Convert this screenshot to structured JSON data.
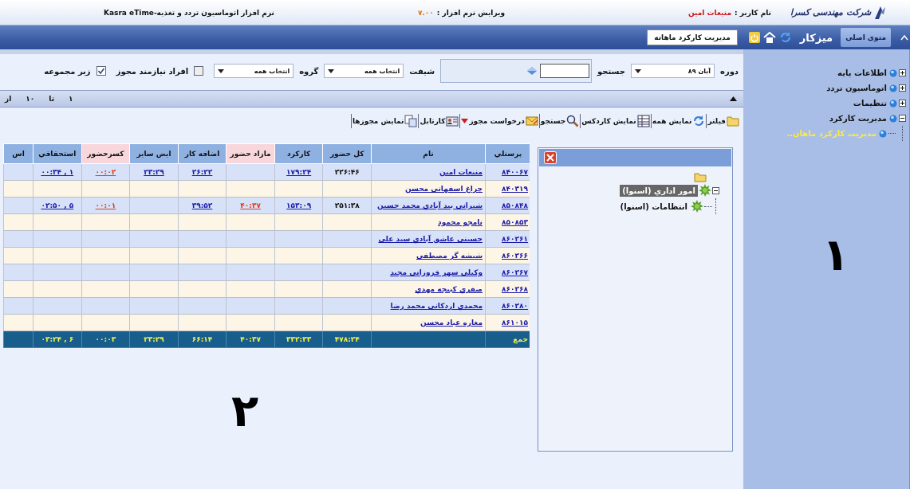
{
  "header": {
    "logo": "شرکت مهندسی کسرا",
    "user_label": "نام کاربر :",
    "user_name": "منيعات امين",
    "version_label": "ويرايش نرم افزار :",
    "version": "۷.۰۰",
    "product": "نرم افزار اتوماسيون تردد و تغذيه-Kasra eTime"
  },
  "nav": {
    "tabs": [
      {
        "label": "منوی اصلی",
        "selected": true
      },
      {
        "label": "ميزکار",
        "selected": false
      }
    ],
    "page_tab": "مديريت کارکرد ماهانه"
  },
  "filters": {
    "period_label": "دوره",
    "period": "آبان ۸۹",
    "search_label": "جستجو",
    "shift_label": "شيفت",
    "shift": "انتخاب همه",
    "group_label": "گروه",
    "group": "انتخاب همه",
    "checkboxes": [
      {
        "label": "افراد نيازمند مجوز",
        "checked": false
      },
      {
        "label": "زير مجموعه",
        "checked": true
      }
    ]
  },
  "pager": [
    "۱",
    "تا",
    "۱۰",
    "از"
  ],
  "toolbar": [
    {
      "label": "فيلتر",
      "kind": "folder",
      "dropdown": false
    },
    {
      "label": "نمايش همه",
      "kind": "refresh",
      "dropdown": false
    },
    {
      "label": "نمايش کاردکس",
      "kind": "grid",
      "dropdown": false
    },
    {
      "label": "جستجو",
      "kind": "search",
      "dropdown": false
    },
    {
      "label": "درخواست مجوز",
      "kind": "envelope",
      "dropdown": true
    },
    {
      "label": "کارتابل",
      "kind": "card",
      "dropdown": false
    },
    {
      "label": "نمايش مجوزها",
      "kind": "copy",
      "dropdown": false
    }
  ],
  "tree_panel": {
    "nodes": [
      {
        "label": "امور اداري (اسنوا)",
        "selected": true,
        "expanded": true,
        "children": [
          {
            "label": "انتظامات (اسنوا)",
            "selected": false
          }
        ]
      }
    ]
  },
  "table": {
    "columns": [
      {
        "label": "پرسنلي",
        "kind": "link"
      },
      {
        "label": "نام",
        "kind": "link"
      },
      {
        "label": "کل حضور",
        "kind": "text"
      },
      {
        "label": "کارکرد",
        "kind": "link"
      },
      {
        "label": "مازاد حضور",
        "kind": "alert"
      },
      {
        "label": "اضافه کار",
        "kind": "link"
      },
      {
        "label": "ايض ساير",
        "kind": "link"
      },
      {
        "label": "کسرحضور",
        "kind": "alert"
      },
      {
        "label": "استحقاقي",
        "kind": "link"
      },
      {
        "label": "اس",
        "kind": "link"
      }
    ],
    "rows": [
      {
        "personnel": "۸۴۰۰۶۷",
        "name": "منيعات امين",
        "presence": "۲۲۶:۴۶",
        "work": "۱۷۹:۲۴",
        "overtime": "۲۶:۲۲",
        "other": "۲۳:۲۹",
        "deficit": "۰۰:۰۲",
        "entitlement": "۰۰:۳۴ , ۱"
      },
      {
        "personnel": "۸۴۰۳۱۹",
        "name": "چراغ اسفهاني محسن"
      },
      {
        "personnel": "۸۵۰۸۴۸",
        "name": "شيراني بيد آبادي محمد حسين",
        "presence": "۲۵۱:۳۸",
        "work": "۱۵۳:۰۹",
        "surplus": "۴۰:۳۷",
        "overtime": "۳۹:۵۲",
        "deficit": "۰۰:۰۱",
        "entitlement": "۰۲:۵۰ , ۵"
      },
      {
        "personnel": "۸۵۰۸۵۳",
        "name": "نامجو محمود"
      },
      {
        "personnel": "۸۶۰۲۶۱",
        "name": "حسيني عاشق آبادي سيد علي"
      },
      {
        "personnel": "۸۶۰۲۶۶",
        "name": "شيشه گر مصطفي"
      },
      {
        "personnel": "۸۶۰۲۶۷",
        "name": "وکيلي سهر فروزاني مجيد"
      },
      {
        "personnel": "۸۶۰۲۶۸",
        "name": "صفري کبيجه مهدي"
      },
      {
        "personnel": "۸۶۰۲۸۰",
        "name": "محمدي اردکاني محمد رضا"
      },
      {
        "personnel": "۸۶۱۰۱۵",
        "name": "مغاره عباد محسن"
      }
    ],
    "total": {
      "personnel": "جمع",
      "presence": "۴۷۸:۲۴",
      "work": "۳۳۲:۳۳",
      "surplus": "۴۰:۳۷",
      "overtime": "۶۶:۱۴",
      "other": "۲۳:۲۹",
      "deficit": "۰۰:۰۳",
      "entitlement": "۰۳:۲۴ , ۶"
    }
  },
  "main_marker": "۲",
  "sidebar": {
    "tree": [
      {
        "label": "اطلاعات پايه",
        "selected": false,
        "expanded": false
      },
      {
        "label": "اتوماسيون تردد",
        "selected": false,
        "expanded": false
      },
      {
        "label": "تنظيمات",
        "selected": false,
        "expanded": false
      },
      {
        "label": "مديريت کارکرد",
        "selected": false,
        "expanded": true,
        "children": [
          {
            "label": "مديريت کارکرد ماهان..",
            "selected": true
          }
        ]
      }
    ],
    "marker": "۱"
  }
}
